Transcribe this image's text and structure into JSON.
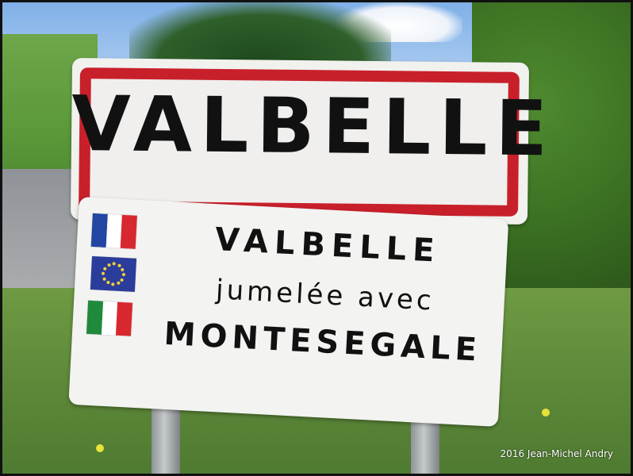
{
  "sign": {
    "town_name": "VALBELLE",
    "twinning": {
      "town": "VALBELLE",
      "phrase": "jumelée avec",
      "partner": "MONTESEGALE"
    },
    "border_color": "#c8202b"
  },
  "flags": [
    {
      "name": "france-flag",
      "colors": [
        "#2346a3",
        "#ffffff",
        "#d8282f"
      ]
    },
    {
      "name": "eu-flag",
      "colors": [
        "#2b3d9b",
        "#f4d23a"
      ]
    },
    {
      "name": "italy-flag",
      "colors": [
        "#1f8a3c",
        "#ffffff",
        "#d8282f"
      ]
    }
  ],
  "credit": "2016 Jean-Michel Andry"
}
